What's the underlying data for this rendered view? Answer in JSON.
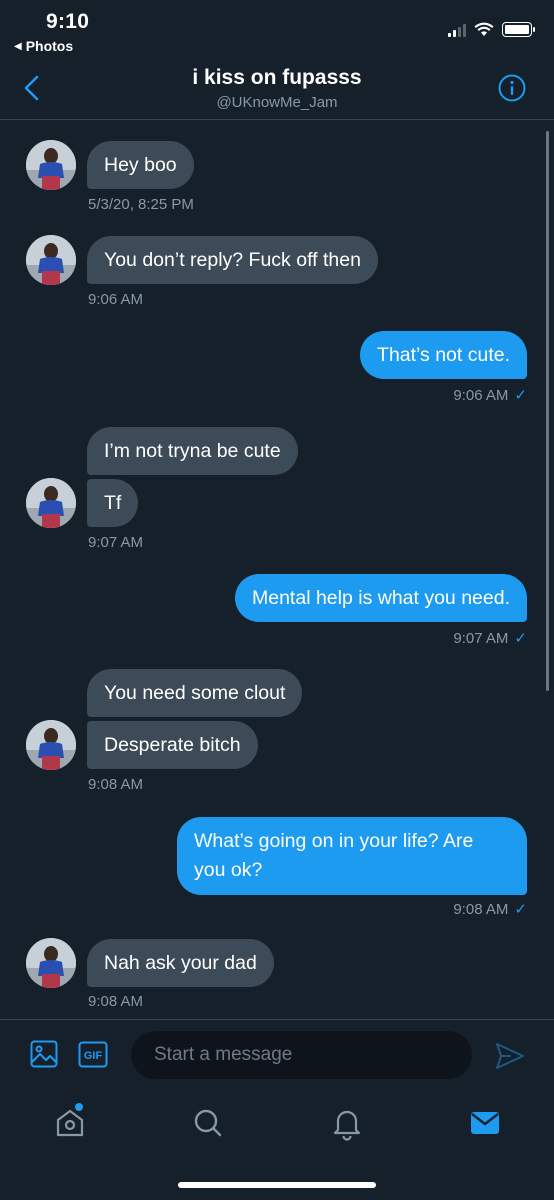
{
  "status_bar": {
    "time": "9:10",
    "back_app": "Photos"
  },
  "header": {
    "title": "i kiss on fupasss",
    "handle": "@UKnowMe_Jam"
  },
  "messages": [
    {
      "direction": "in",
      "text": "Hey boo",
      "timestamp": "5/3/20, 8:25 PM"
    },
    {
      "direction": "in",
      "text": "You don’t reply? Fuck off then",
      "timestamp": "9:06 AM"
    },
    {
      "direction": "out",
      "text": "That’s not cute.",
      "timestamp": "9:06 AM"
    },
    {
      "direction": "in",
      "text": "I’m not tryna be cute"
    },
    {
      "direction": "in",
      "text": "Tf",
      "timestamp": "9:07 AM"
    },
    {
      "direction": "out",
      "text": "Mental help is what you need.",
      "timestamp": "9:07 AM"
    },
    {
      "direction": "in",
      "text": "You need some clout"
    },
    {
      "direction": "in",
      "text": "Desperate bitch",
      "timestamp": "9:08 AM"
    },
    {
      "direction": "out",
      "text": "What’s going on in your life? Are you ok?",
      "timestamp": "9:08 AM"
    },
    {
      "direction": "in",
      "text": "Nah ask your dad",
      "timestamp": "9:08 AM"
    }
  ],
  "read_receipt": "✓",
  "composer": {
    "placeholder": "Start a message"
  },
  "colors": {
    "background": "#15202b",
    "incoming_bubble": "#3d4a57",
    "outgoing_bubble": "#1d9bf0",
    "accent": "#1d9bf0",
    "muted_text": "#8899a6"
  },
  "icons": {
    "back": "chevron-left-icon",
    "info": "info-icon",
    "media": "image-icon",
    "gif": "gif-icon",
    "send": "send-icon",
    "tabs": [
      "home-icon",
      "search-icon",
      "bell-icon",
      "mail-icon"
    ]
  }
}
